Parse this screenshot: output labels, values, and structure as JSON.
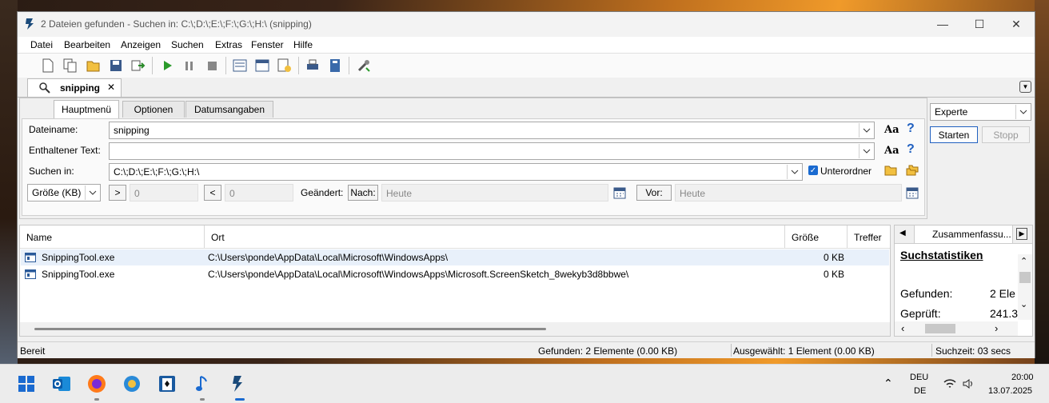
{
  "window": {
    "title": "2 Dateien gefunden - Suchen in: C:\\;D:\\;E:\\;F:\\;G:\\;H:\\ (snipping)"
  },
  "menu": [
    "Datei",
    "Bearbeiten",
    "Anzeigen",
    "Suchen",
    "Extras",
    "Fenster",
    "Hilfe"
  ],
  "doc_tab": {
    "label": "snipping"
  },
  "panel_tabs": [
    "Hauptmenü",
    "Optionen",
    "Datumsangaben"
  ],
  "form": {
    "filename_label": "Dateiname:",
    "filename_value": "snipping",
    "text_label": "Enthaltener Text:",
    "text_value": "",
    "searchin_label": "Suchen in:",
    "searchin_value": "C:\\;D:\\;E:\\;F:\\;G:\\;H:\\",
    "subfolders_label": "Unterordner",
    "subfolders_checked": true,
    "size_unit": "Größe (KB)",
    "gt_label": ">",
    "gt_value": "0",
    "lt_label": "<",
    "lt_value": "0",
    "changed_label": "Geändert:",
    "after_label": "Nach:",
    "after_value": "Heute",
    "before_label": "Vor:",
    "before_value": "Heute",
    "aa_label": "Aa",
    "help_label": "?"
  },
  "side": {
    "mode": "Experte",
    "start_label": "Starten",
    "stop_label": "Stopp"
  },
  "results": {
    "columns": [
      "Name",
      "Ort",
      "Größe",
      "Treffer"
    ],
    "rows": [
      {
        "name": "SnippingTool.exe",
        "ort": "C:\\Users\\ponde\\AppData\\Local\\Microsoft\\WindowsApps\\",
        "size": "0 KB"
      },
      {
        "name": "SnippingTool.exe",
        "ort": "C:\\Users\\ponde\\AppData\\Local\\Microsoft\\WindowsApps\\Microsoft.ScreenSketch_8wekyb3d8bbwe\\",
        "size": "0 KB"
      }
    ]
  },
  "stats": {
    "tab_label": "Zusammenfassu...",
    "heading": "Suchstatistiken",
    "found_label": "Gefunden:",
    "found_value": "2 Ele",
    "checked_label": "Geprüft:",
    "checked_value": "241.3"
  },
  "status": {
    "ready": "Bereit",
    "found": "Gefunden: 2 Elemente (0.00 KB)",
    "selected": "Ausgewählt: 1 Element (0.00 KB)",
    "time": "Suchzeit: 03 secs"
  },
  "taskbar": {
    "lang_top": "DEU",
    "lang_bottom": "DE",
    "time": "20:00",
    "date": "13.07.2025"
  }
}
